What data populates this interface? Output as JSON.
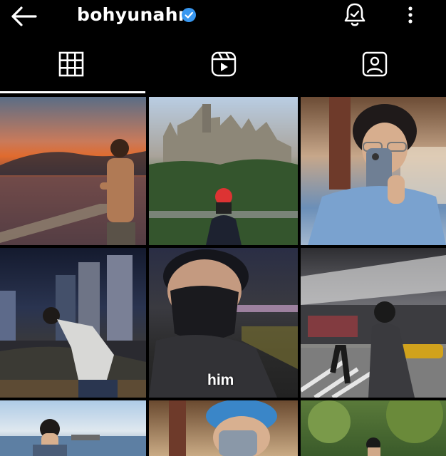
{
  "header": {
    "username": "bohyunahn",
    "verified_color": "#3897f0",
    "icons": {
      "back": "back-arrow-icon",
      "notifications": "bell-icon",
      "more": "more-vertical-icon"
    }
  },
  "tabs": [
    {
      "name": "posts",
      "icon": "grid-icon",
      "active": true
    },
    {
      "name": "reels",
      "icon": "reels-icon",
      "active": false
    },
    {
      "name": "tagged",
      "icon": "tagged-person-icon",
      "active": false
    }
  ],
  "posts": [
    {
      "id": 1,
      "caption": ""
    },
    {
      "id": 2,
      "caption": ""
    },
    {
      "id": 3,
      "caption": ""
    },
    {
      "id": 4,
      "caption": ""
    },
    {
      "id": 5,
      "caption": "him"
    },
    {
      "id": 6,
      "caption": ""
    },
    {
      "id": 7,
      "caption": ""
    },
    {
      "id": 8,
      "caption": ""
    },
    {
      "id": 9,
      "caption": ""
    }
  ]
}
